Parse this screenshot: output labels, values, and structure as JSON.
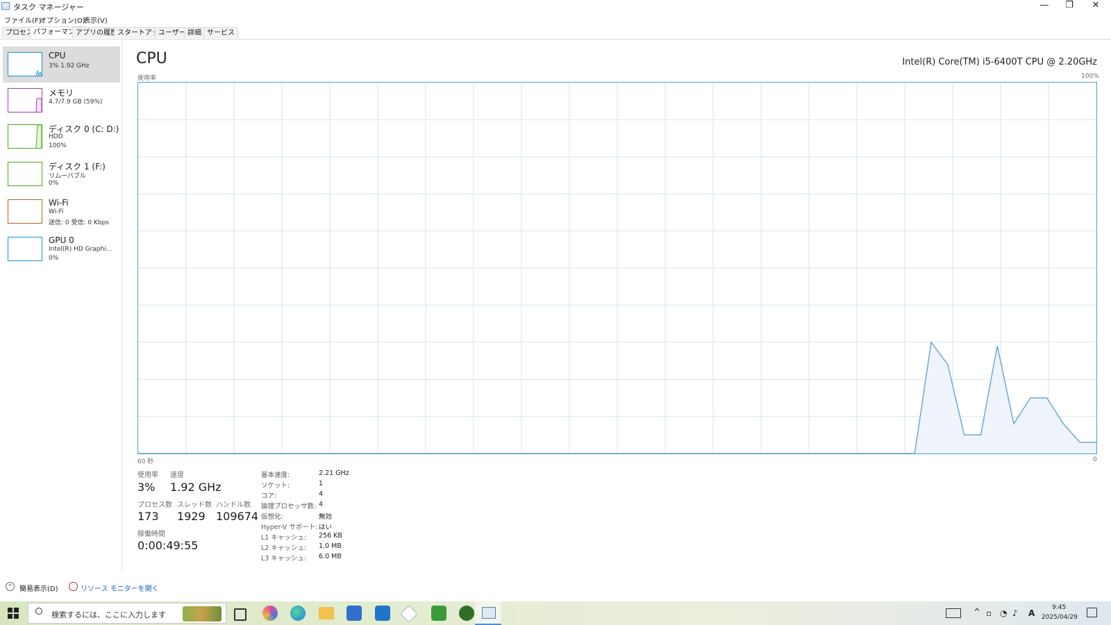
{
  "window": {
    "title": "タスク マネージャー",
    "minimize_glyph": "—",
    "restore_glyph": "❐",
    "close_glyph": "✕"
  },
  "menu": [
    "ファイル(F)",
    "オプション(O)",
    "表示(V)"
  ],
  "tabs": [
    "プロセス",
    "パフォーマンス",
    "アプリの履歴",
    "スタートアップ",
    "ユーザー",
    "詳細",
    "サービス"
  ],
  "active_tab": "パフォーマンス",
  "sidebar": [
    {
      "name": "CPU",
      "lines": [
        "3%  1.92 GHz"
      ],
      "color": "#1a8fd1"
    },
    {
      "name": "メモリ",
      "lines": [
        "4.7/7.9 GB (59%)"
      ],
      "color": "#9b3fb5"
    },
    {
      "name": "ディスク 0 (C: D:)",
      "lines": [
        "HDD",
        "100%"
      ],
      "color": "#4caa14"
    },
    {
      "name": "ディスク 1 (F:)",
      "lines": [
        "リムーバブル",
        "0%"
      ],
      "color": "#4caa14"
    },
    {
      "name": "Wi-Fi",
      "lines": [
        "Wi-Fi",
        "送信: 0 受信: 0 Kbps"
      ],
      "color": "#a7661a"
    },
    {
      "name": "GPU 0",
      "lines": [
        "Intel(R) HD Graphi...",
        "0%"
      ],
      "color": "#1a8fd1"
    }
  ],
  "main": {
    "title": "CPU",
    "model": "Intel(R) Core(TM) i5-6400T CPU @ 2.20GHz",
    "graph_label": "使用率",
    "graph_max": "100%",
    "graph_time": "60 秒",
    "graph_min": "0",
    "usage_series": [
      0,
      0,
      0,
      0,
      0,
      0,
      0,
      0,
      0,
      0,
      0,
      0,
      0,
      0,
      0,
      0,
      0,
      0,
      0,
      0,
      0,
      0,
      0,
      0,
      0,
      0,
      0,
      0,
      0,
      0,
      0,
      0,
      0,
      0,
      0,
      0,
      0,
      0,
      0,
      0,
      0,
      0,
      0,
      0,
      0,
      0,
      0,
      0,
      30,
      24,
      5,
      5,
      29,
      8,
      15,
      15,
      8,
      3,
      3
    ],
    "graph_line_color": "#6fa8cf",
    "graph_fill_color": "#eef4fa",
    "graph_grid_color": "#d5e6f2"
  },
  "stats": {
    "usage_label": "使用率",
    "usage": "3%",
    "speed_label": "速度",
    "speed": "1.92 GHz",
    "proc_label": "プロセス数",
    "proc": "173",
    "thread_label": "スレッド数",
    "thread": "1929",
    "handle_label": "ハンドル数",
    "handle": "109674",
    "uptime_label": "稼働時間",
    "uptime": "0:00:49:55"
  },
  "specs": [
    {
      "label": "基本速度:",
      "value": "2.21 GHz"
    },
    {
      "label": "ソケット:",
      "value": "1"
    },
    {
      "label": "コア:",
      "value": "4"
    },
    {
      "label": "論理プロセッサ数:",
      "value": "4"
    },
    {
      "label": "仮想化:",
      "value": "無効"
    },
    {
      "label": "Hyper-V サポート:",
      "value": "はい"
    },
    {
      "label": "L1 キャッシュ:",
      "value": "256 KB"
    },
    {
      "label": "L2 キャッシュ:",
      "value": "1.0 MB"
    },
    {
      "label": "L3 キャッシュ:",
      "value": "6.0 MB"
    }
  ],
  "footer": {
    "fewer_details": "簡易表示(D)",
    "resource_monitor": "リソース モニターを開く"
  },
  "taskbar": {
    "search_placeholder": "検索するには、ここに入力します",
    "apps": [
      "task-view-icon",
      "copilot-icon",
      "edge-icon",
      "file-explorer-icon",
      "store-icon",
      "mail-icon",
      "dropbox-icon",
      "evernote-icon",
      "tripadvisor-icon",
      "task-manager-icon"
    ],
    "time": "9:45",
    "date": "2025/04/29",
    "ime": "A"
  }
}
